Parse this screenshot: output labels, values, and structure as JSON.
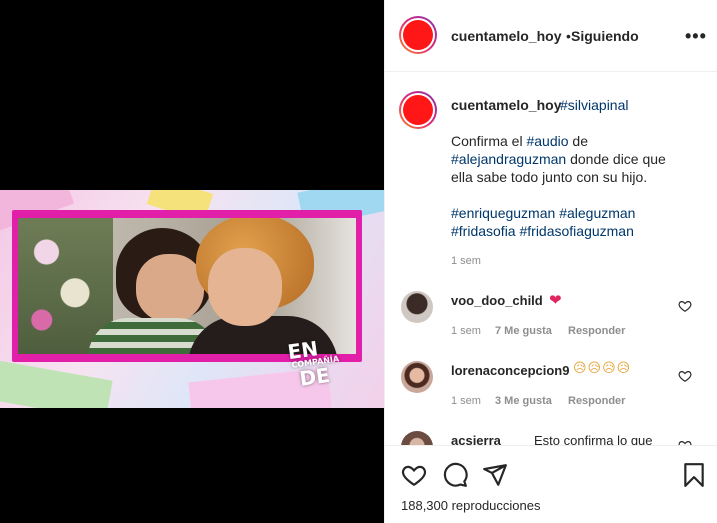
{
  "post": {
    "username": "cuentamelo_hoy",
    "separator": "•",
    "follow_status": "Siguiendo",
    "more_label": "•••",
    "avatar_color": "#ff1616"
  },
  "caption": {
    "username": "cuentamelo_hoy",
    "tag_inline": "#silviapinal",
    "line1_text": "Confirma el ",
    "line1_tag": "#audio",
    "line1_tail": " de",
    "line2_tag": "#alejandraguzman",
    "line2_tail": " donde dice que",
    "line3": "ella sabe todo junto con su hijo.",
    "tags_line1_a": "#enriqueguzman",
    "tags_line1_b": "#aleguzman",
    "tags_line2_a": "#fridasofia",
    "tags_line2_b": "#fridasofiaguzman",
    "time": "1 sem"
  },
  "comments": [
    {
      "username": "voo_doo_child",
      "text": "❤",
      "time": "1 sem",
      "likes": "7 Me gusta",
      "reply": "Responder"
    },
    {
      "username": "lorenaconcepcion9",
      "text": "😥😥😥😥",
      "time": "1 sem",
      "likes": "3 Me gusta",
      "reply": "Responder"
    },
    {
      "username": "acsierra",
      "text": "Esto confirma lo que"
    }
  ],
  "video": {
    "watermark_line1": "EN",
    "watermark_line2": "COMPAÑÍA",
    "watermark_line3": "DE",
    "frame_color": "#e11fa8"
  },
  "actions": {
    "like_icon": "heart-icon",
    "comment_icon": "comment-icon",
    "share_icon": "send-icon",
    "save_icon": "bookmark-icon",
    "views": "188,300 reproducciones"
  },
  "colors": {
    "hashtag": "#00376b",
    "muted": "#8e8e8e",
    "text": "#262626"
  }
}
